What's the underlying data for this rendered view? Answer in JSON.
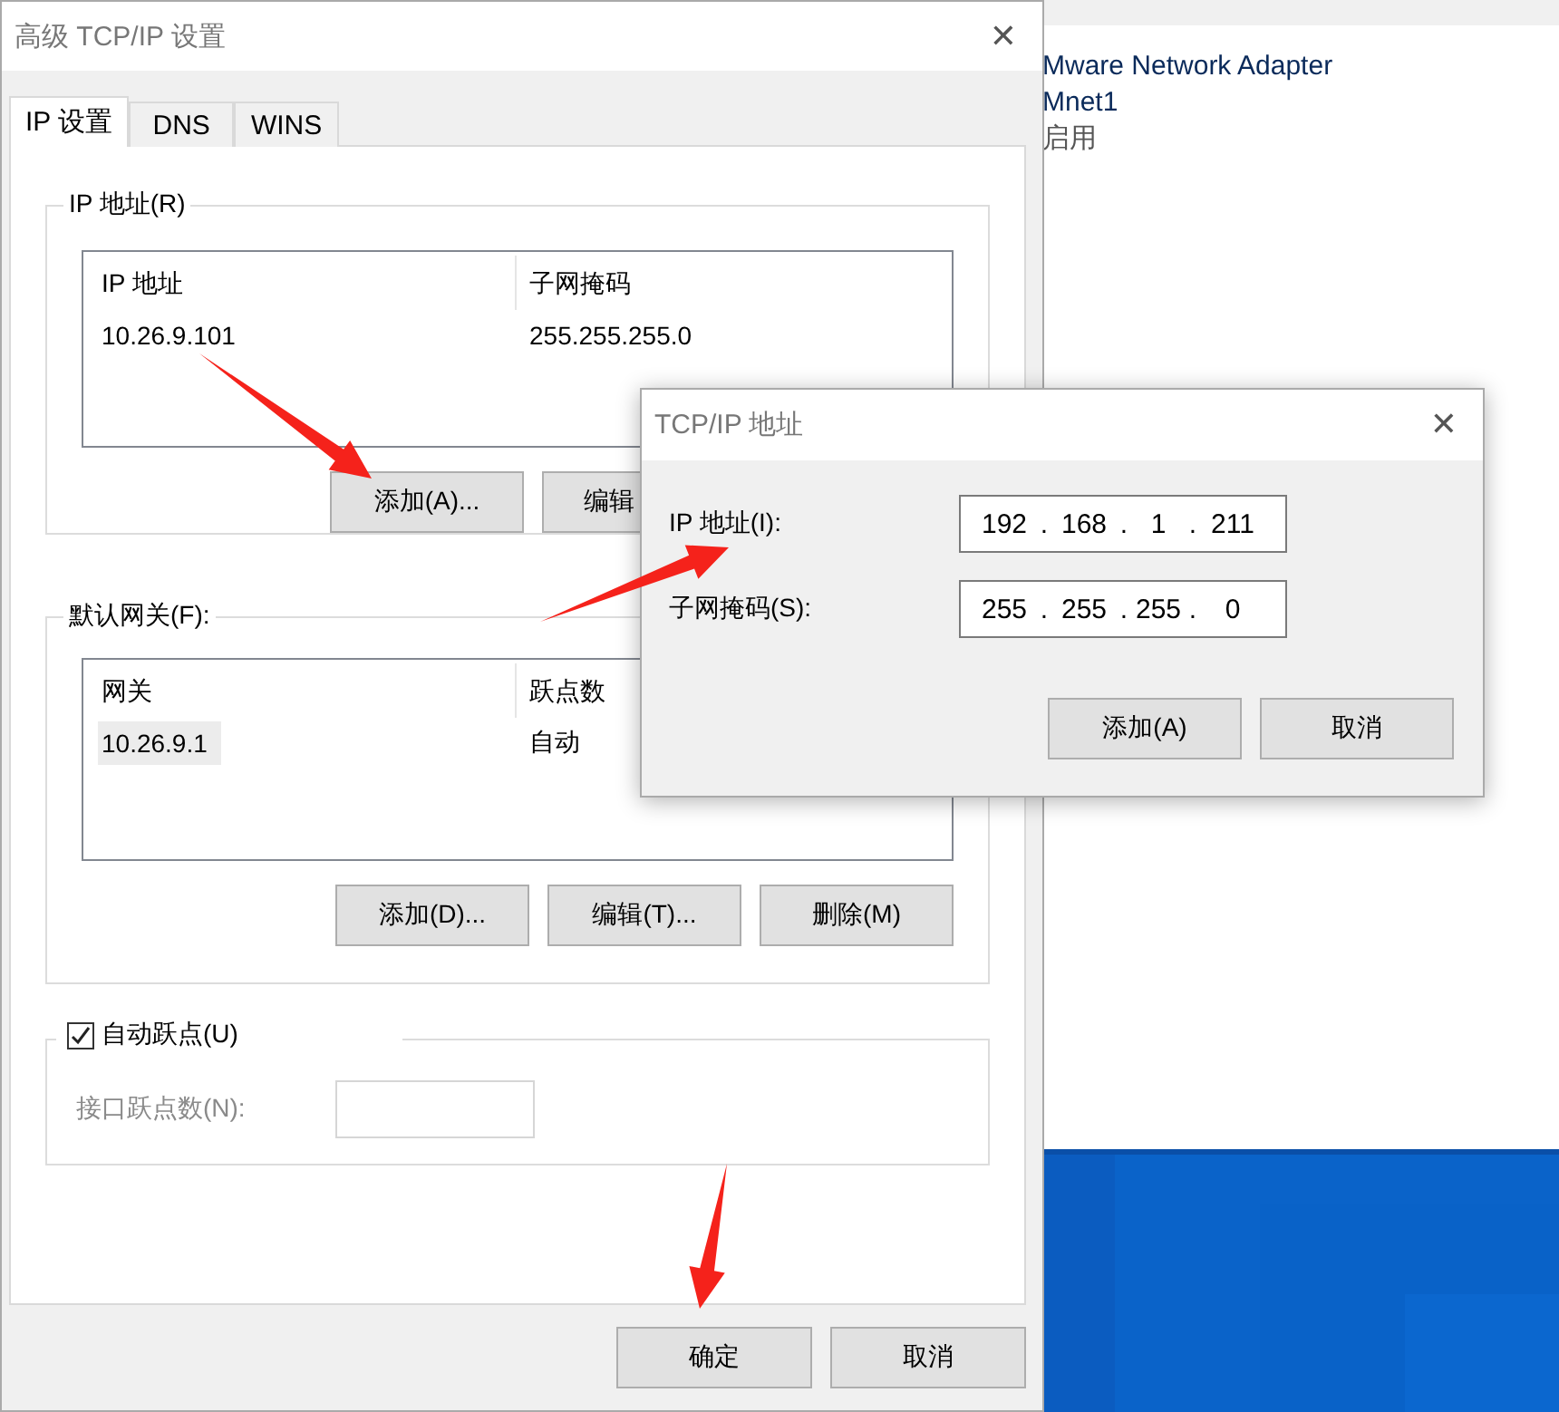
{
  "background_window": {
    "lines": [
      "Mware Network Adapter",
      "Mnet1",
      "启用"
    ]
  },
  "dialog": {
    "title": "高级 TCP/IP 设置",
    "close": "✕",
    "tabs": [
      {
        "label": "IP 设置",
        "selected": true
      },
      {
        "label": "DNS",
        "selected": false
      },
      {
        "label": "WINS",
        "selected": false
      }
    ],
    "ip_group": {
      "legend": "IP 地址(R)",
      "columns": [
        "IP 地址",
        "子网掩码"
      ],
      "rows": [
        {
          "cells": [
            "10.26.9.101",
            "255.255.255.0"
          ],
          "selected": false
        }
      ],
      "buttons": [
        "添加(A)...",
        "编辑"
      ]
    },
    "gateway_group": {
      "legend": "默认网关(F):",
      "columns": [
        "网关",
        "跃点数"
      ],
      "rows": [
        {
          "cells": [
            "10.26.9.1",
            "自动"
          ],
          "selected": true
        }
      ],
      "buttons": [
        "添加(D)...",
        "编辑(T)...",
        "删除(M)"
      ]
    },
    "metric_group": {
      "checkbox": {
        "label": "自动跃点(U)",
        "checked": true
      },
      "field_label": "接口跃点数(N):",
      "disabled": true
    },
    "buttons": [
      "确定",
      "取消"
    ]
  },
  "sub_dialog": {
    "title": "TCP/IP 地址",
    "close": "✕",
    "dot": ".",
    "fields": [
      {
        "label": "IP 地址(I):",
        "octets": [
          "192",
          "168",
          "1",
          "211"
        ]
      },
      {
        "label": "子网掩码(S):",
        "octets": [
          "255",
          "255",
          "255",
          "0"
        ]
      }
    ],
    "buttons": [
      "添加(A)",
      "取消"
    ]
  }
}
